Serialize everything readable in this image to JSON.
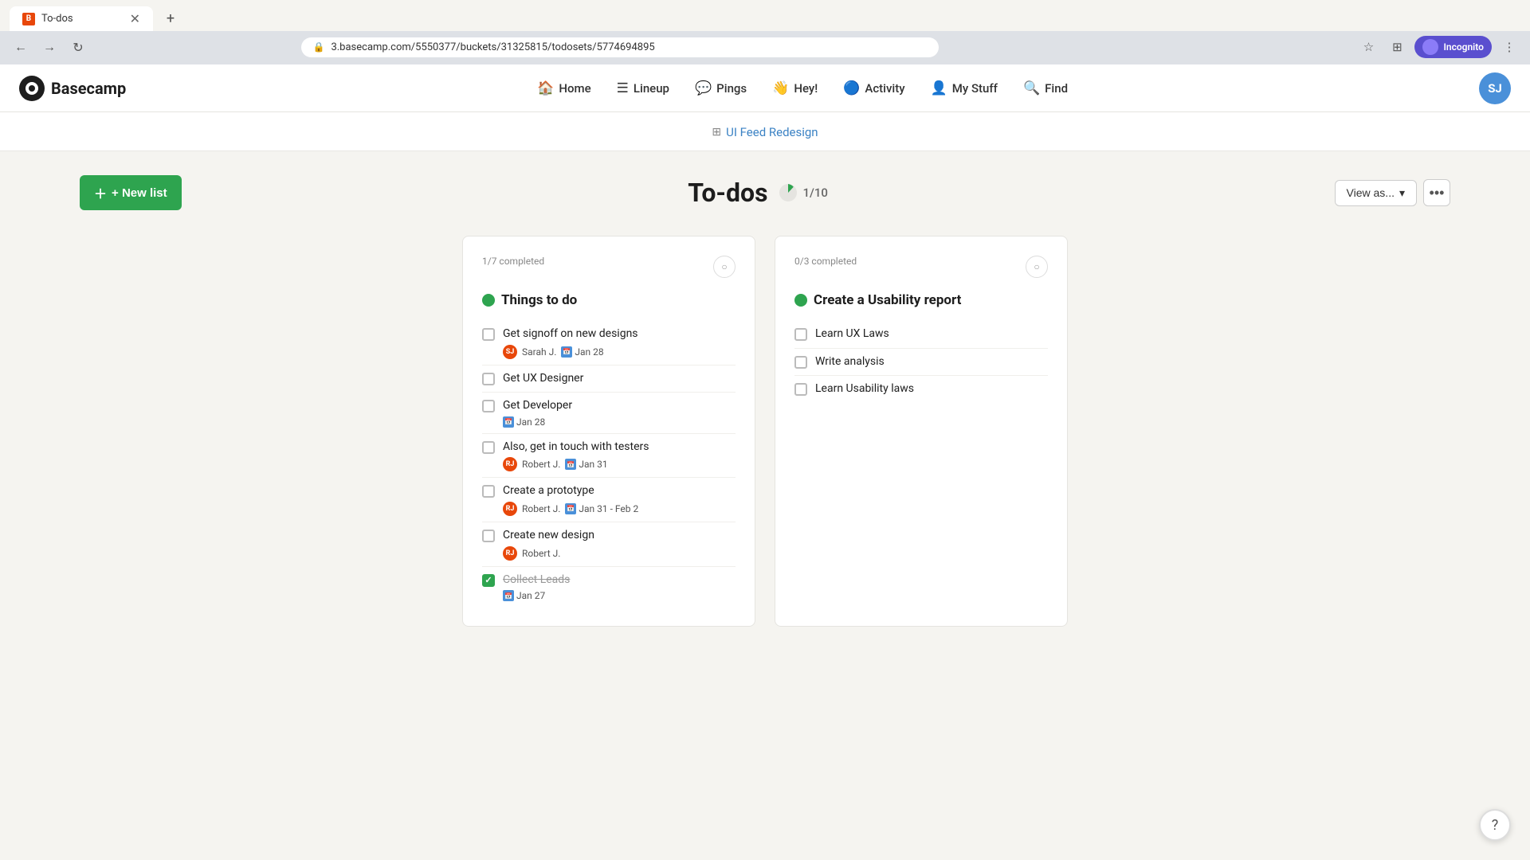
{
  "browser": {
    "tab_title": "To-dos",
    "tab_favicon_text": "B",
    "url": "3.basecamp.com/5550377/buckets/31325815/todosets/5774694895",
    "new_tab_label": "+",
    "nav_back": "←",
    "nav_forward": "→",
    "nav_refresh": "↻",
    "star_icon": "☆",
    "extensions_icon": "⊞",
    "profile_label": "Incognito",
    "more_icon": "⋮"
  },
  "topnav": {
    "logo_text": "Basecamp",
    "items": [
      {
        "id": "home",
        "label": "Home",
        "icon": "🏠"
      },
      {
        "id": "lineup",
        "label": "Lineup",
        "icon": "☰"
      },
      {
        "id": "pings",
        "label": "Pings",
        "icon": "💬"
      },
      {
        "id": "hey",
        "label": "Hey!",
        "icon": "👋"
      },
      {
        "id": "activity",
        "label": "Activity",
        "icon": "🔵"
      },
      {
        "id": "mystuff",
        "label": "My Stuff",
        "icon": "👤"
      },
      {
        "id": "find",
        "label": "Find",
        "icon": "🔍"
      }
    ],
    "user_initials": "SJ"
  },
  "breadcrumb": {
    "project_name": "UI Feed Redesign",
    "grid_icon": "⊞"
  },
  "page": {
    "new_list_label": "+ New list",
    "title": "To-dos",
    "progress_text": "1/10",
    "progress_value": 10,
    "view_as_label": "View as...",
    "more_label": "•••",
    "chevron": "▾"
  },
  "list1": {
    "completed_meta": "1/7 completed",
    "title": "Things to do",
    "status_color": "#2ea44f",
    "todos": [
      {
        "id": "t1",
        "text": "Get signoff on new designs",
        "checked": false,
        "assignee": "Sarah J.",
        "assignee_initials": "SJ",
        "assignee_color": "#e8470a",
        "has_date": true,
        "has_attach": true,
        "date": "Jan 28"
      },
      {
        "id": "t2",
        "text": "Get UX Designer",
        "checked": false,
        "assignee": null,
        "has_date": false,
        "date": ""
      },
      {
        "id": "t3",
        "text": "Get Developer",
        "checked": false,
        "assignee": null,
        "has_date": true,
        "has_attach": false,
        "date": "Jan 28"
      },
      {
        "id": "t4",
        "text": "Also, get in touch with testers",
        "checked": false,
        "assignee": "Robert J.",
        "assignee_initials": "RJ",
        "assignee_color": "#e8470a",
        "has_date": true,
        "has_attach": true,
        "date": "Jan 31"
      },
      {
        "id": "t5",
        "text": "Create a prototype",
        "checked": false,
        "assignee": "Robert J.",
        "assignee_initials": "RJ",
        "assignee_color": "#e8470a",
        "has_date": true,
        "has_attach": true,
        "date": "Jan 31 - Feb 2"
      },
      {
        "id": "t6",
        "text": "Create new design",
        "checked": false,
        "assignee": "Robert J.",
        "assignee_initials": "RJ",
        "assignee_color": "#e8470a",
        "has_date": false,
        "date": ""
      },
      {
        "id": "t7",
        "text": "Collect Leads",
        "checked": true,
        "assignee": null,
        "has_date": true,
        "date": "Jan 27"
      }
    ]
  },
  "list2": {
    "completed_meta": "0/3 completed",
    "title": "Create a Usability report",
    "status_color": "#2ea44f",
    "todos": [
      {
        "id": "u1",
        "text": "Learn UX Laws",
        "checked": false
      },
      {
        "id": "u2",
        "text": "Write analysis",
        "checked": false
      },
      {
        "id": "u3",
        "text": "Learn Usability laws",
        "checked": false
      }
    ]
  },
  "help": {
    "icon": "?"
  }
}
